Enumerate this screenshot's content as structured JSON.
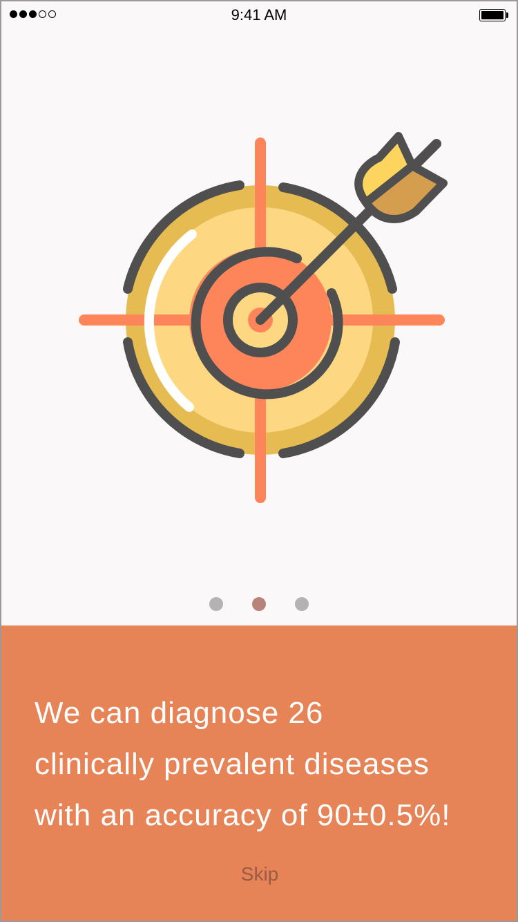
{
  "status_bar": {
    "time": "9:41 AM",
    "signal_bars_filled": 3,
    "signal_bars_total": 5,
    "battery_icon": "battery-full-icon"
  },
  "onboarding": {
    "illustration_icon": "target-arrow-icon",
    "page_indicator": {
      "total": 3,
      "active_index": 1
    },
    "message_lines": [
      "We can diagnose 26",
      "clinically prevalent diseases",
      "with an accuracy of 90±0.5%!"
    ],
    "skip_label": "Skip"
  },
  "colors": {
    "panel": "#e68457",
    "background": "#faf8f8",
    "indicator_active": "#b8847a",
    "indicator_inactive": "#b3b3b3",
    "target_outer": "#e6bb52",
    "target_inner": "#fdd781",
    "bullseye": "#fe855a",
    "crosshair": "#fe855a",
    "outline": "#4f4f4f",
    "fletching_light": "#fdd45e",
    "fletching_dark": "#d59e4e"
  }
}
